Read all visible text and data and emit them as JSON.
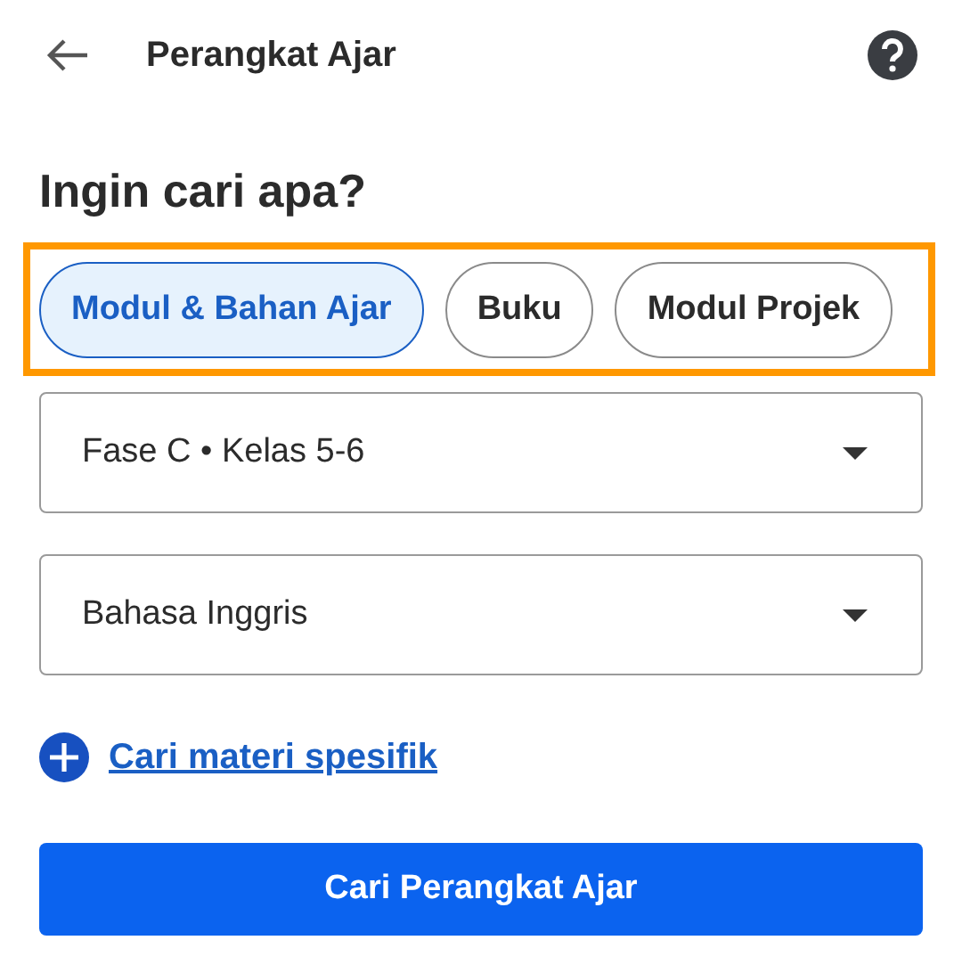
{
  "header": {
    "title": "Perangkat Ajar"
  },
  "heading": "Ingin cari apa?",
  "chips": [
    {
      "label": "Modul & Bahan Ajar",
      "selected": true
    },
    {
      "label": "Buku",
      "selected": false
    },
    {
      "label": "Modul Projek",
      "selected": false
    }
  ],
  "dropdowns": [
    {
      "value": "Fase C • Kelas 5-6"
    },
    {
      "value": "Bahasa Inggris"
    }
  ],
  "link": "Cari materi spesifik",
  "button": "Cari Perangkat Ajar"
}
